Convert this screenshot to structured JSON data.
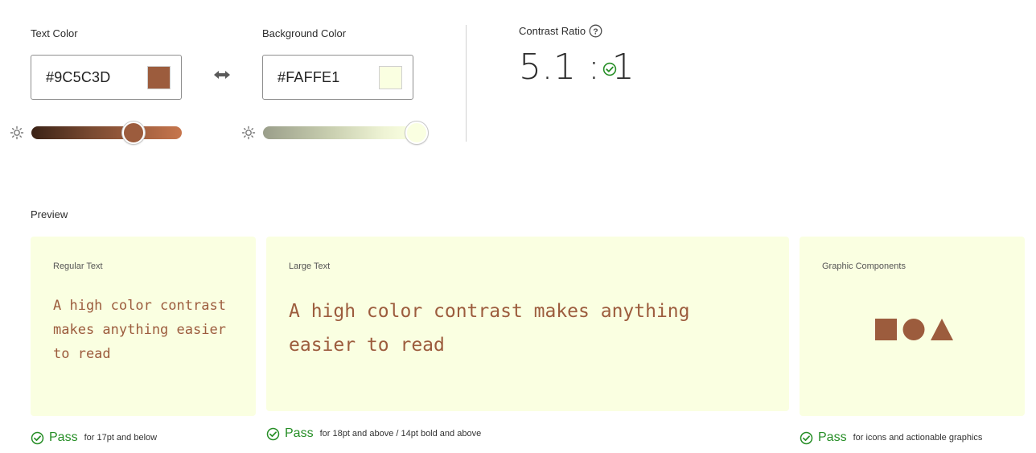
{
  "colors": {
    "text": "#9C5C3D",
    "background": "#FAFFE1",
    "pass_green": "#268E26"
  },
  "text_color": {
    "label": "Text Color",
    "hex_value": "#9C5C3D",
    "brightness_level": 0.67
  },
  "background_color": {
    "label": "Background Color",
    "hex_value": "#FAFFE1",
    "brightness_level": 1.0
  },
  "swap_icon": "swap-arrows-icon",
  "contrast": {
    "title": "Contrast Ratio",
    "value": "5.1 : 1",
    "help_icon": "question-circle-icon",
    "status_icon": "check-circle-icon"
  },
  "preview": {
    "title": "Preview",
    "regular": {
      "label": "Regular Text",
      "sample": "A high color contrast makes anything easier to read",
      "result": "Pass",
      "note": "for 17pt and below"
    },
    "large": {
      "label": "Large Text",
      "sample": "A high color contrast makes anything easier to read",
      "result": "Pass",
      "note": "for 18pt and above / 14pt bold and above"
    },
    "graphic": {
      "label": "Graphic Components",
      "shapes": [
        "square",
        "circle",
        "triangle"
      ],
      "result": "Pass",
      "note": "for icons and actionable graphics"
    }
  }
}
